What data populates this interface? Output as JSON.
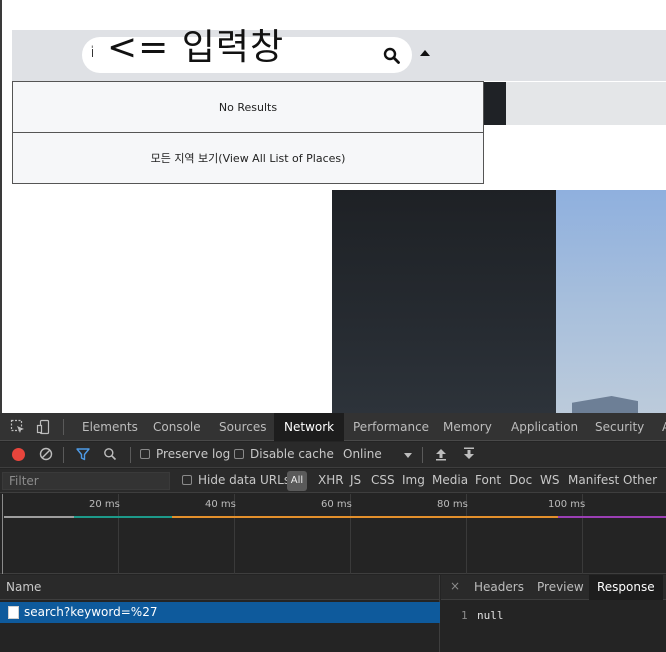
{
  "page": {
    "search": {
      "value": "'",
      "annotation": "<= 입력창",
      "search_icon": "search-icon",
      "toggle_icon": "caret-up-icon"
    },
    "dropdown": {
      "items": [
        "No Results",
        "모든 지역 보기(View All List of Places)"
      ]
    }
  },
  "devtools": {
    "tabs": [
      "Elements",
      "Console",
      "Sources",
      "Network",
      "Performance",
      "Memory",
      "Application",
      "Security",
      "A"
    ],
    "active_tab": "Network",
    "toolbar": {
      "preserve_log": "Preserve log",
      "disable_cache": "Disable cache",
      "throttle": "Online"
    },
    "filter": {
      "placeholder": "Filter",
      "hide_data_urls": "Hide data URLs",
      "all": "All",
      "types": [
        "XHR",
        "JS",
        "CSS",
        "Img",
        "Media",
        "Font",
        "Doc",
        "WS",
        "Manifest",
        "Other"
      ]
    },
    "timeline": {
      "ticks": [
        "20 ms",
        "40 ms",
        "60 ms",
        "80 ms",
        "100 ms"
      ]
    },
    "requests": {
      "header": "Name",
      "rows": [
        "search?keyword=%27"
      ]
    },
    "detail": {
      "close": "×",
      "tabs": [
        "Headers",
        "Preview",
        "Response"
      ],
      "active": "Response",
      "line_number": "1",
      "response": "null"
    },
    "colors": {
      "record": "#e8453c",
      "selected_row": "#0e5a9c",
      "filter_icon": "#4d9ae5"
    }
  }
}
